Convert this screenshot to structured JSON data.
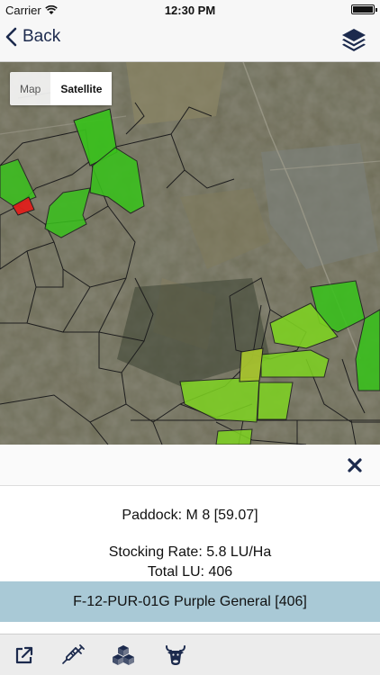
{
  "status": {
    "carrier": "Carrier",
    "time": "12:30 PM"
  },
  "nav": {
    "back_label": "Back",
    "layers_icon": "layers-icon"
  },
  "map": {
    "toggle": {
      "map_label": "Map",
      "satellite_label": "Satellite",
      "selected": "Satellite"
    },
    "colors": {
      "satellite_base": "#5a5a4a",
      "paddock_green": "#39c11c",
      "paddock_light_green": "#7ed321",
      "paddock_yellow_green": "#a6c22e",
      "paddock_red": "#e0201c",
      "boundary": "#1e1e1e"
    }
  },
  "panel": {
    "close_icon": "close-icon",
    "paddock": "Paddock: M 8 [59.07]",
    "stocking_rate": "Stocking Rate: 5.8 LU/Ha",
    "total_lu": "Total LU: 406",
    "herd": "F-12-PUR-01G Purple General [406]",
    "herd_row_color": "#a9c9d6"
  },
  "tabbar": {
    "items": [
      {
        "icon": "export-icon"
      },
      {
        "icon": "syringe-icon"
      },
      {
        "icon": "cubes-icon"
      },
      {
        "icon": "cow-head-icon"
      }
    ],
    "accent": "#1c2a4d"
  }
}
